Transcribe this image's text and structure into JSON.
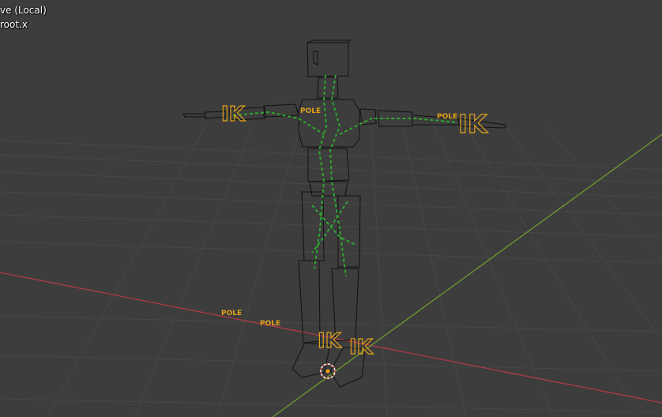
{
  "viewport": {
    "view_name": "ve (Local)",
    "active_object": "root.x"
  },
  "colors": {
    "background": "#3d3d3d",
    "grid": "#4a4a4a",
    "axis_x": "#b03a48",
    "axis_y": "#6e9a2e",
    "wire": "#111111",
    "bone": "#2ea82e",
    "controller": "#e0a21a",
    "cursor_red": "#e0403a"
  },
  "labels": {
    "ik": "IK",
    "pole": "POLE",
    "pole_chest": "POLE"
  }
}
